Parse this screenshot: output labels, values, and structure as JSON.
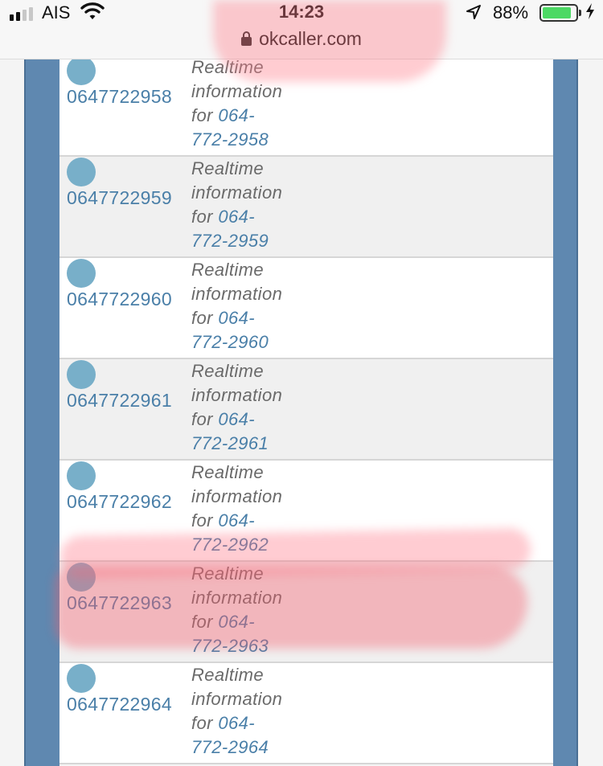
{
  "status_bar": {
    "carrier": "AIS",
    "time": "14:23",
    "battery_percent": "88%",
    "battery_level": 0.88,
    "icons": [
      "signal-icon",
      "wifi-icon",
      "location-arrow-icon",
      "battery-icon",
      "charging-bolt-icon"
    ]
  },
  "url_bar": {
    "domain": "okcaller.com",
    "icon": "lock-icon"
  },
  "colors": {
    "frame": "#5f88b0",
    "link": "#4a7fa8",
    "avatar": "#78afc9",
    "highlight": "#ff7887"
  },
  "rows": [
    {
      "number": "0647722958",
      "desc_line1": "Realtime",
      "desc_line2": "information",
      "desc_for": "for",
      "link_part1": "064-",
      "link_part2": "772-2958"
    },
    {
      "number": "0647722959",
      "desc_line1": "Realtime",
      "desc_line2": "information",
      "desc_for": "for",
      "link_part1": "064-",
      "link_part2": "772-2959"
    },
    {
      "number": "0647722960",
      "desc_line1": "Realtime",
      "desc_line2": "information",
      "desc_for": "for",
      "link_part1": "064-",
      "link_part2": "772-2960"
    },
    {
      "number": "0647722961",
      "desc_line1": "Realtime",
      "desc_line2": "information",
      "desc_for": "for",
      "link_part1": "064-",
      "link_part2": "772-2961"
    },
    {
      "number": "0647722962",
      "desc_line1": "Realtime",
      "desc_line2": "information",
      "desc_for": "for",
      "link_part1": "064-",
      "link_part2": "772-2962"
    },
    {
      "number": "0647722963",
      "desc_line1": "Realtime",
      "desc_line2": "information",
      "desc_for": "for",
      "link_part1": "064-",
      "link_part2": "772-2963"
    },
    {
      "number": "0647722964",
      "desc_line1": "Realtime",
      "desc_line2": "information",
      "desc_for": "for",
      "link_part1": "064-",
      "link_part2": "772-2964"
    }
  ]
}
